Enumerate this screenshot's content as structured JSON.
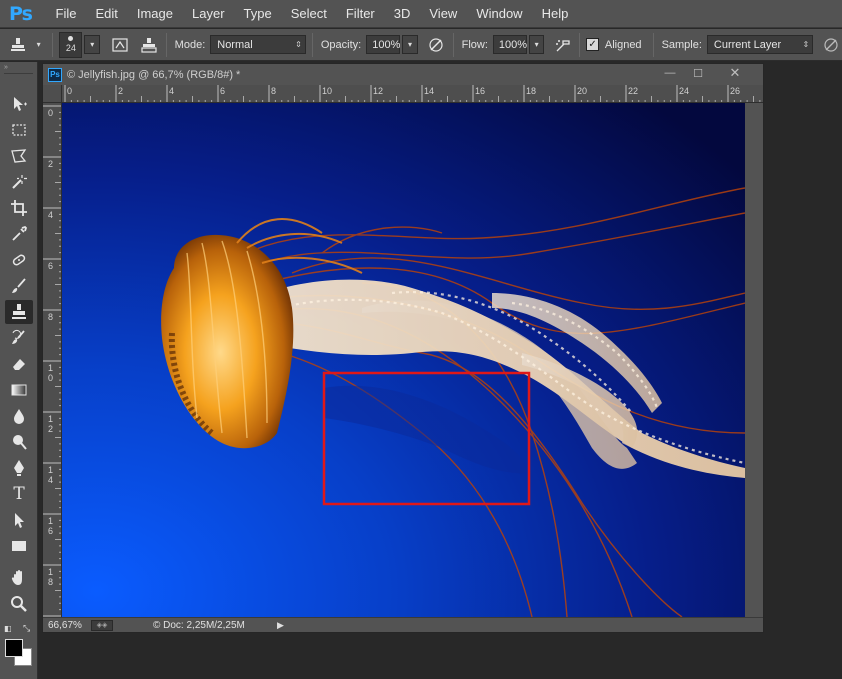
{
  "app": {
    "logo": "Ps"
  },
  "menu": [
    "File",
    "Edit",
    "Image",
    "Layer",
    "Type",
    "Select",
    "Filter",
    "3D",
    "View",
    "Window",
    "Help"
  ],
  "options_bar": {
    "brush_size": "24",
    "mode_label": "Mode:",
    "mode_value": "Normal",
    "opacity_label": "Opacity:",
    "opacity_value": "100%",
    "flow_label": "Flow:",
    "flow_value": "100%",
    "aligned_label": "Aligned",
    "aligned_checked": true,
    "sample_label": "Sample:",
    "sample_value": "Current Layer"
  },
  "tools": [
    "move-tool-icon",
    "rectangular-marquee-icon",
    "polygonal-lasso-icon",
    "magic-wand-icon",
    "crop-icon",
    "eyedropper-icon",
    "spot-healing-brush-icon",
    "brush-icon",
    "clone-stamp-icon",
    "history-brush-icon",
    "eraser-icon",
    "gradient-icon",
    "blur-icon",
    "dodge-icon",
    "pen-icon",
    "type-icon",
    "path-selection-icon",
    "rectangle-shape-icon",
    "hand-icon",
    "zoom-icon"
  ],
  "active_tool": "clone-stamp-icon",
  "colors": {
    "foreground": "#000000",
    "background": "#ffffff",
    "selection_box": "#e01818"
  },
  "document": {
    "title": "© Jellyfish.jpg @ 66,7% (RGB/8#) *",
    "icon_text": "Ps",
    "ruler_top": [
      "0",
      "2",
      "4",
      "6",
      "8",
      "10",
      "12",
      "14",
      "16",
      "18",
      "20",
      "22",
      "24",
      "26"
    ],
    "ruler_left": [
      "0",
      "2",
      "4",
      "6",
      "8",
      "10",
      "12",
      "14",
      "16",
      "18",
      "2"
    ],
    "zoom": "66,67%",
    "doc_size": "© Doc: 2,25M/2,25M"
  }
}
